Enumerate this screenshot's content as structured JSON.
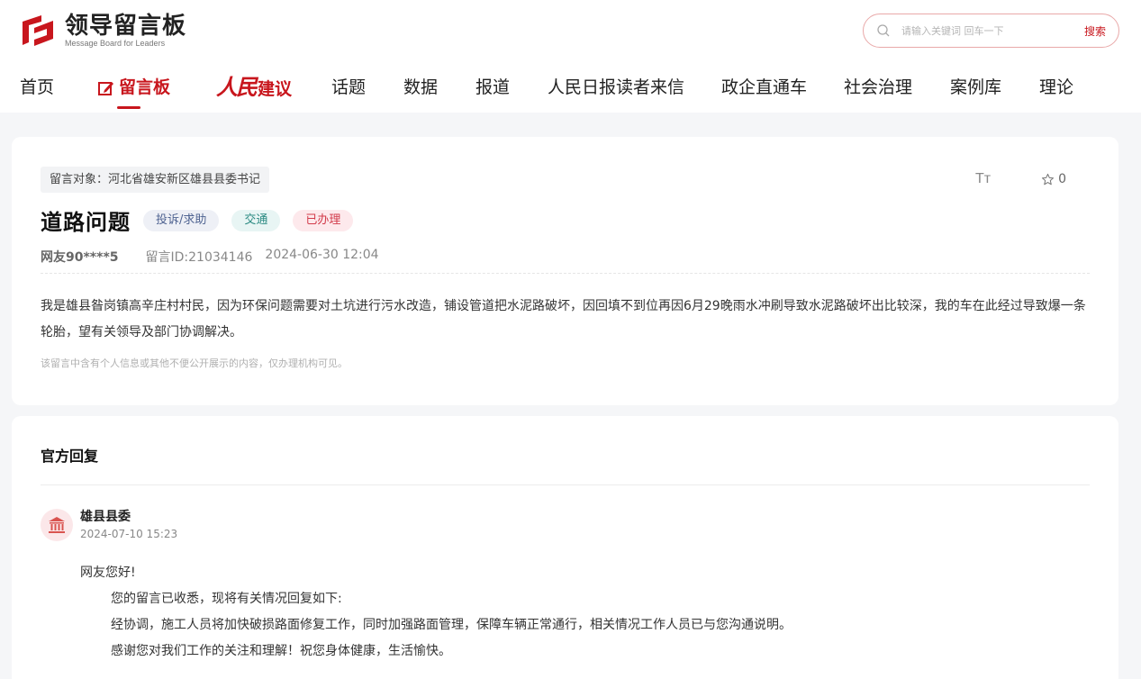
{
  "header": {
    "logo_title": "领导留言板",
    "logo_subtitle": "Message Board for Leaders",
    "search": {
      "placeholder": "请输入关键词 回车一下",
      "button": "搜索"
    }
  },
  "nav": {
    "items": [
      {
        "label": "首页"
      },
      {
        "label": "留言板",
        "active": true
      },
      {
        "label_script": "人民",
        "label": "建议"
      },
      {
        "label": "话题"
      },
      {
        "label": "数据"
      },
      {
        "label": "报道"
      },
      {
        "label": "人民日报读者来信"
      },
      {
        "label": "政企直通车"
      },
      {
        "label": "社会治理"
      },
      {
        "label": "案例库"
      },
      {
        "label": "理论"
      }
    ]
  },
  "message": {
    "target": "留言对象：河北省雄安新区雄县县委书记",
    "font_toggle": "Tт",
    "favorite_count": "0",
    "title": "道路问题",
    "tags": [
      "投诉/求助",
      "交通",
      "已办理"
    ],
    "user": "网友90****5",
    "message_id": "留言ID:21034146",
    "datetime": "2024-06-30 12:04",
    "content": "我是雄县昝岗镇高辛庄村村民，因为环保问题需要对土坑进行污水改造，铺设管道把水泥路破坏，因回填不到位再因6月29晚雨水冲刷导致水泥路破坏出比较深，我的车在此经过导致爆一条轮胎，望有关领导及部门协调解决。",
    "notice": "该留言中含有个人信息或其他不便公开展示的内容，仅办理机构可见。"
  },
  "reply": {
    "heading": "官方回复",
    "org": "雄县县委",
    "datetime": "2024-07-10 15:23",
    "greeting": "网友您好!",
    "lines": [
      "您的留言已收悉，现将有关情况回复如下:",
      "经协调，施工人员将加快破损路面修复工作，同时加强路面管理，保障车辆正常通行，相关情况工作人员已与您沟通说明。",
      "感谢您对我们工作的关注和理解！祝您身体健康，生活愉快。"
    ]
  },
  "colors": {
    "brand_red": "#c8161d",
    "tag_gray_bg": "#eef0f6",
    "tag_green_bg": "#e8f5f4",
    "tag_red_bg": "#fde9ec"
  }
}
